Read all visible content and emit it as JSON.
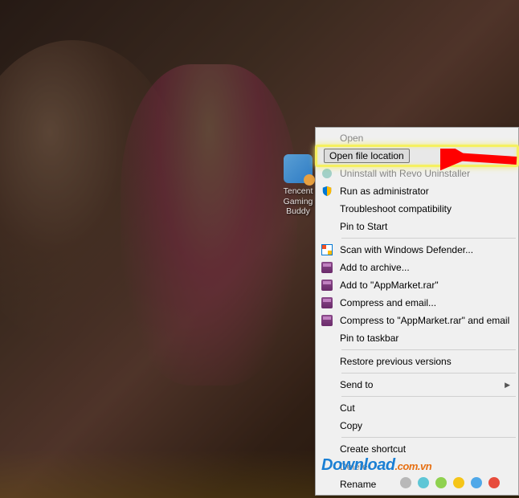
{
  "desktop_icon": {
    "label": "Tencent Gaming Buddy"
  },
  "context_menu": {
    "items": [
      {
        "label": "Open",
        "icon": null,
        "dimmed": true
      },
      {
        "label": "Open file location",
        "icon": null,
        "highlighted": true
      },
      {
        "label": "Uninstall with Revo Uninstaller",
        "icon": "revo-icon",
        "dimmed": true
      },
      {
        "label": "Run as administrator",
        "icon": "shield-icon"
      },
      {
        "label": "Troubleshoot compatibility",
        "icon": null
      },
      {
        "label": "Pin to Start",
        "icon": null
      },
      {
        "sep": true
      },
      {
        "label": "Scan with Windows Defender...",
        "icon": "defender-icon"
      },
      {
        "label": "Add to archive...",
        "icon": "winrar-icon"
      },
      {
        "label": "Add to \"AppMarket.rar\"",
        "icon": "winrar-icon"
      },
      {
        "label": "Compress and email...",
        "icon": "winrar-icon"
      },
      {
        "label": "Compress to \"AppMarket.rar\" and email",
        "icon": "winrar-icon"
      },
      {
        "label": "Pin to taskbar",
        "icon": null
      },
      {
        "sep": true
      },
      {
        "label": "Restore previous versions",
        "icon": null
      },
      {
        "sep": true
      },
      {
        "label": "Send to",
        "icon": null,
        "submenu": true
      },
      {
        "sep": true
      },
      {
        "label": "Cut",
        "icon": null
      },
      {
        "label": "Copy",
        "icon": null
      },
      {
        "sep": true
      },
      {
        "label": "Create shortcut",
        "icon": null
      },
      {
        "label": "Delete",
        "icon": null,
        "dimmed": true
      },
      {
        "label": "Rename",
        "icon": null
      }
    ]
  },
  "watermark": {
    "text_main": "Download",
    "text_suffix": ".com.vn"
  },
  "dots": [
    "#b8b8b8",
    "#5ec6d6",
    "#8fd14f",
    "#f5c518",
    "#4fa8e8",
    "#e74c3c"
  ]
}
